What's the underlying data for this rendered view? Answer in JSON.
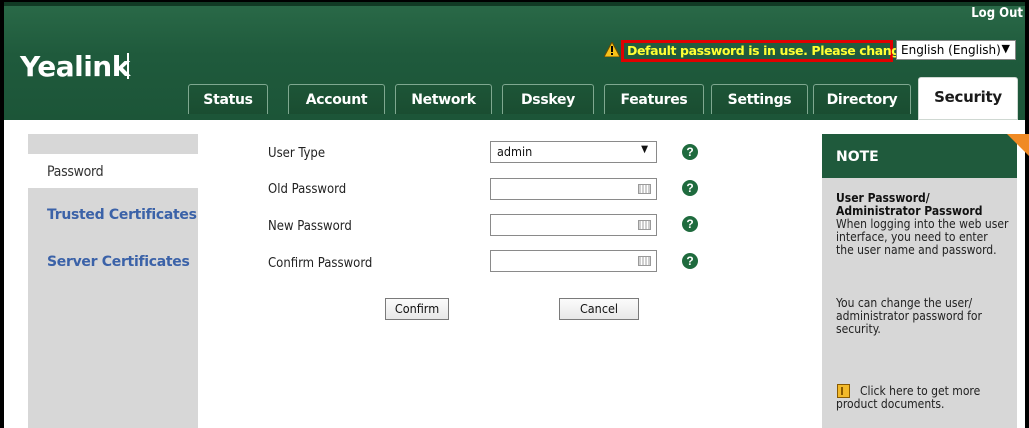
{
  "header": {
    "logo": "Yealink",
    "logout": "Log Out",
    "warning": "Default password is in use. Please change!",
    "language": "English (English)"
  },
  "tabs": [
    {
      "label": "Status"
    },
    {
      "label": "Account"
    },
    {
      "label": "Network"
    },
    {
      "label": "Dsskey"
    },
    {
      "label": "Features"
    },
    {
      "label": "Settings"
    },
    {
      "label": "Directory"
    },
    {
      "label": "Security"
    }
  ],
  "sidebar": {
    "items": [
      {
        "label": "Password"
      },
      {
        "label": "Trusted Certificates"
      },
      {
        "label": "Server Certificates"
      }
    ]
  },
  "form": {
    "user_type_label": "User Type",
    "user_type_value": "admin",
    "old_password_label": "Old Password",
    "new_password_label": "New Password",
    "confirm_password_label": "Confirm Password",
    "confirm_button": "Confirm",
    "cancel_button": "Cancel"
  },
  "note": {
    "title": "NOTE",
    "heading_line1": "User Password/",
    "heading_line2": "Administrator Password",
    "body_line1": "When logging into the web user",
    "body_line2": "interface, you need to enter",
    "body_line3": "the user name and password.",
    "change_line1": "You can change the user/",
    "change_line2": "administrator password for",
    "change_line3": "security.",
    "docs_line1": "Click here to get more",
    "docs_line2": "product documents."
  },
  "colors": {
    "header_green": "#1f5a3c",
    "warning_text": "#ffff33",
    "warning_border": "#e00000",
    "link_blue": "#3b62a8",
    "note_corner": "#f08a24"
  },
  "icons": {
    "warning": "warning-triangle-icon",
    "help": "help-question-icon",
    "keyboard": "keyboard-icon",
    "document": "document-icon"
  }
}
